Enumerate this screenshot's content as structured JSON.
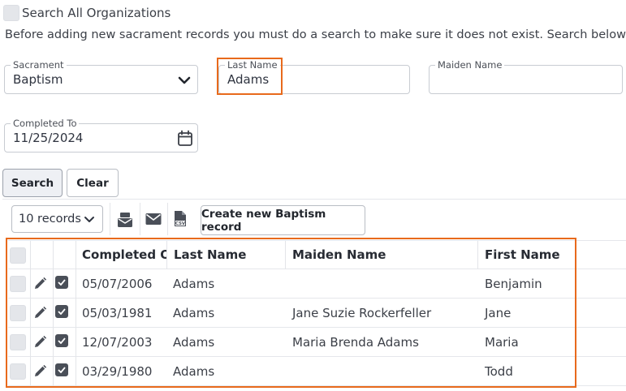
{
  "search_all": {
    "label": "Search All Organizations",
    "checked": false
  },
  "instructions": "Before adding new sacrament records you must do a search to make sure it does not exist. Search below.",
  "form": {
    "sacrament": {
      "label": "Sacrament",
      "value": "Baptism"
    },
    "last_name": {
      "label": "Last Name",
      "value": "Adams"
    },
    "maiden_name": {
      "label": "Maiden Name",
      "value": ""
    },
    "completed_to": {
      "label": "Completed To",
      "value": "11/25/2024"
    }
  },
  "buttons": {
    "search": "Search",
    "clear": "Clear",
    "create": "Create new Baptism record"
  },
  "toolbar": {
    "records_select": "10 records"
  },
  "icons": {
    "accent": "#e86a1c"
  },
  "table": {
    "columns": [
      "Completed On",
      "Last Name",
      "Maiden Name",
      "First Name"
    ],
    "rows": [
      {
        "completed": "05/07/2006",
        "last": "Adams",
        "maiden": "",
        "first": "Benjamin"
      },
      {
        "completed": "05/03/1981",
        "last": "Adams",
        "maiden": "Jane Suzie Rockerfeller",
        "first": "Jane"
      },
      {
        "completed": "12/07/2003",
        "last": "Adams",
        "maiden": "Maria Brenda Adams",
        "first": "Maria"
      },
      {
        "completed": "03/29/1980",
        "last": "Adams",
        "maiden": "",
        "first": "Todd"
      }
    ]
  }
}
